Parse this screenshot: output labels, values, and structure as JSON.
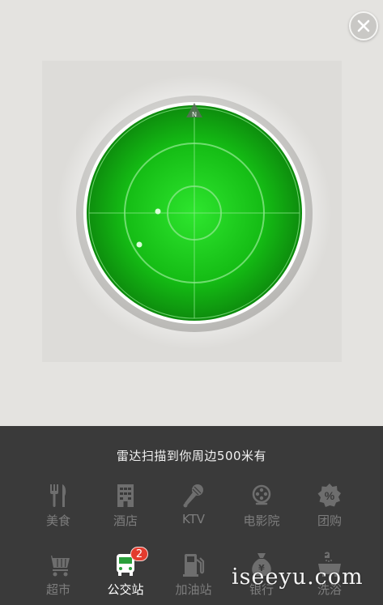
{
  "close": {
    "icon": "close-icon"
  },
  "radar": {
    "north_label": "N",
    "colors": {
      "screen": "#17c217",
      "rim": "#d9d8d5",
      "grid": "#a6f0a6"
    }
  },
  "panel": {
    "scan_text": "雷达扫描到你周边500米有",
    "categories": [
      {
        "label": "美食",
        "icon": "utensils-icon"
      },
      {
        "label": "酒店",
        "icon": "hotel-icon"
      },
      {
        "label": "KTV",
        "icon": "microphone-icon"
      },
      {
        "label": "电影院",
        "icon": "film-reel-icon"
      },
      {
        "label": "团购",
        "icon": "percent-badge-icon"
      },
      {
        "label": "超市",
        "icon": "cart-icon"
      },
      {
        "label": "公交站",
        "icon": "bus-icon",
        "badge": "2",
        "active": true
      },
      {
        "label": "加油站",
        "icon": "fuel-pump-icon"
      },
      {
        "label": "银行",
        "icon": "money-bag-icon"
      },
      {
        "label": "洗浴",
        "icon": "bathtub-icon"
      }
    ]
  },
  "watermark": "iseeyu.com"
}
